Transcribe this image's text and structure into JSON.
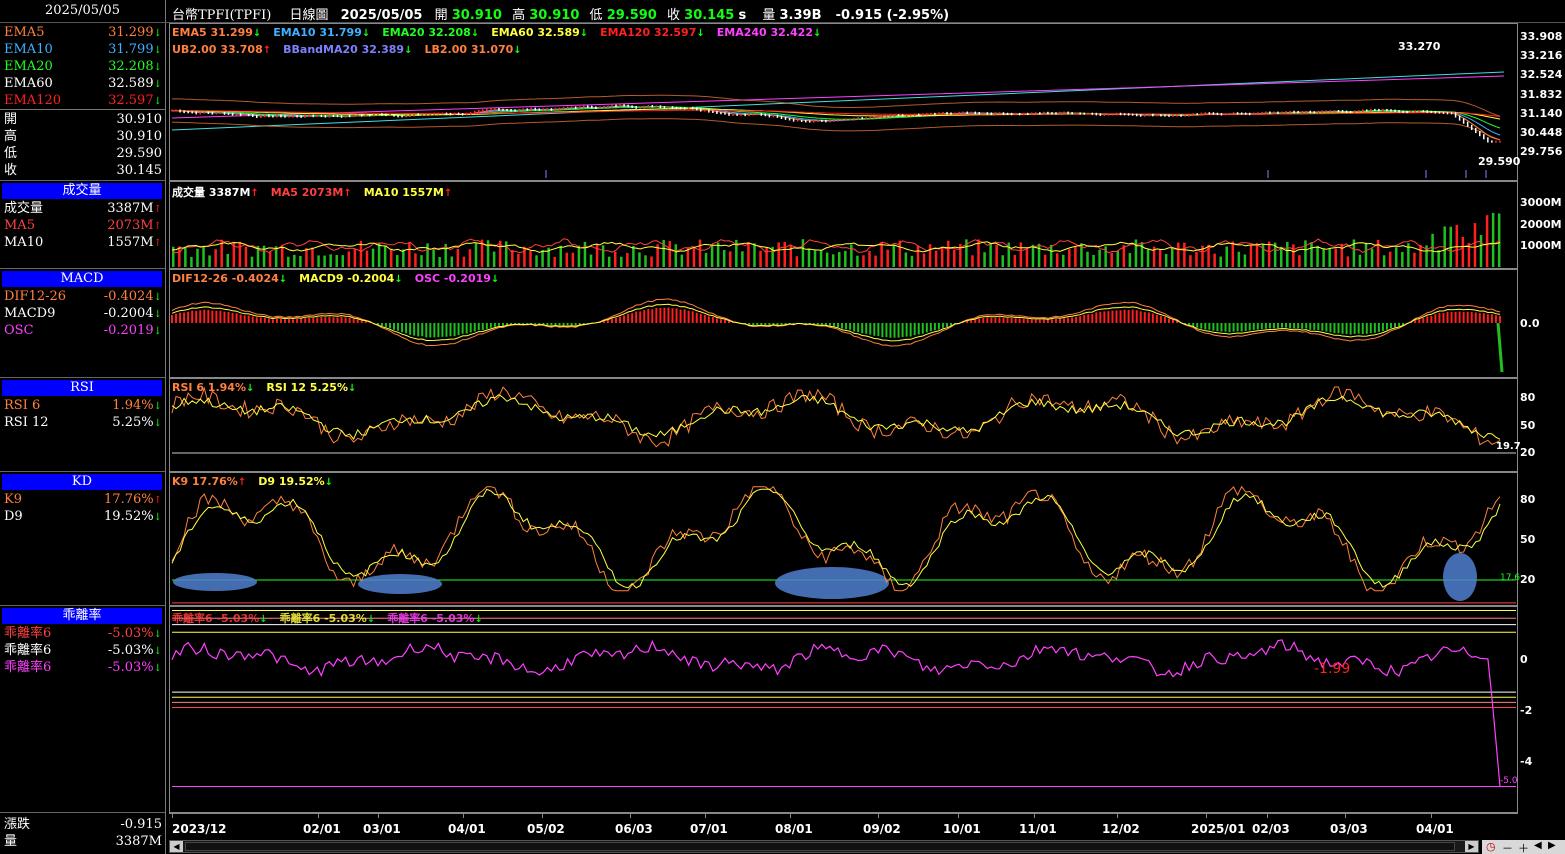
{
  "header": {
    "date": "2025/05/05",
    "instrument": "台幣TPFI(TPFI)",
    "period": "日線圖",
    "bar_date": "2025/05/05",
    "open_label": "開",
    "open": "30.910",
    "high_label": "高",
    "high": "30.910",
    "low_label": "低",
    "low": "29.590",
    "close_label": "收",
    "close": "30.145",
    "close_suffix": "s",
    "vol_label": "量",
    "vol": "3.39B",
    "change": "-0.915 (-2.95%)"
  },
  "sidebar": {
    "ema": [
      {
        "label": "EMA5",
        "value": "31.299",
        "color": "#ff8040",
        "dir": "down"
      },
      {
        "label": "EMA10",
        "value": "31.799",
        "color": "#40b0ff",
        "dir": "down"
      },
      {
        "label": "EMA20",
        "value": "32.208",
        "color": "#20ff20",
        "dir": "down"
      },
      {
        "label": "EMA60",
        "value": "32.589",
        "color": "#ffffff",
        "dir": "down"
      },
      {
        "label": "EMA120",
        "value": "32.597",
        "color": "#ff2020",
        "dir": "down"
      }
    ],
    "ohlc": [
      {
        "label": "開",
        "value": "30.910"
      },
      {
        "label": "高",
        "value": "30.910"
      },
      {
        "label": "低",
        "value": "29.590"
      },
      {
        "label": "收",
        "value": "30.145"
      }
    ],
    "volume": {
      "header": "成交量",
      "rows": [
        {
          "label": "成交量",
          "value": "3387M",
          "color": "#ffffff",
          "dir": "up"
        },
        {
          "label": "MA5",
          "value": "2073M",
          "color": "#ff4040",
          "dir": "up"
        },
        {
          "label": "MA10",
          "value": "1557M",
          "color": "#ffffff",
          "dir": "up"
        }
      ]
    },
    "macd": {
      "header": "MACD",
      "rows": [
        {
          "label": "DIF12-26",
          "value": "-0.4024",
          "color": "#ff8040",
          "dir": "down"
        },
        {
          "label": "MACD9",
          "value": "-0.2004",
          "color": "#ffffff",
          "dir": "down"
        },
        {
          "label": "OSC",
          "value": "-0.2019",
          "color": "#ff40ff",
          "dir": "down"
        }
      ]
    },
    "rsi": {
      "header": "RSI",
      "rows": [
        {
          "label": "RSI 6",
          "value": "1.94%",
          "color": "#ff8040",
          "dir": "down"
        },
        {
          "label": "RSI 12",
          "value": "5.25%",
          "color": "#ffffff",
          "dir": "down"
        }
      ]
    },
    "kd": {
      "header": "KD",
      "rows": [
        {
          "label": "K9",
          "value": "17.76%",
          "color": "#ff8040",
          "dir": "up"
        },
        {
          "label": "D9",
          "value": "19.52%",
          "color": "#ffffff",
          "dir": "down"
        }
      ]
    },
    "bias": {
      "header": "乖離率",
      "rows": [
        {
          "label": "乖離率6",
          "value": "-5.03%",
          "color": "#ff4040",
          "dir": "down"
        },
        {
          "label": "乖離率6",
          "value": "-5.03%",
          "color": "#ffffff",
          "dir": "down"
        },
        {
          "label": "乖離率6",
          "value": "-5.03%",
          "color": "#ff40ff",
          "dir": "down"
        }
      ]
    },
    "bottom": [
      {
        "label": "漲跌",
        "value": "-0.915"
      },
      {
        "label": "量",
        "value": "3387M"
      }
    ]
  },
  "price_panel": {
    "legend1": [
      {
        "text": "EMA5 31.299",
        "color": "#ff8040",
        "dir": "down"
      },
      {
        "text": "EMA10 31.799",
        "color": "#40b0ff",
        "dir": "down"
      },
      {
        "text": "EMA20 32.208",
        "color": "#20ff20",
        "dir": "down"
      },
      {
        "text": "EMA60 32.589",
        "color": "#ffff40",
        "dir": "down"
      },
      {
        "text": "EMA120 32.597",
        "color": "#ff2020",
        "dir": "down"
      },
      {
        "text": "EMA240 32.422",
        "color": "#ff40ff",
        "dir": "down"
      }
    ],
    "legend2": [
      {
        "text": "UB2.00 33.708",
        "color": "#ff8040",
        "dir": "up"
      },
      {
        "text": "BBandMA20 32.389",
        "color": "#8080ff",
        "dir": "down"
      },
      {
        "text": "LB2.00 31.070",
        "color": "#ff8040",
        "dir": "down"
      }
    ],
    "y_ticks": [
      "33.908",
      "33.216",
      "32.524",
      "31.832",
      "31.140",
      "30.448",
      "29.756"
    ],
    "high_mark": "33.270",
    "low_mark": "29.590"
  },
  "volume_panel": {
    "legend": [
      {
        "text": "成交量 3387M",
        "color": "#ffffff",
        "dir": "up"
      },
      {
        "text": "MA5 2073M",
        "color": "#ff4040",
        "dir": "up"
      },
      {
        "text": "MA10 1557M",
        "color": "#ffff40",
        "dir": "up"
      }
    ],
    "y_ticks": [
      "3000M",
      "2000M",
      "1000M"
    ]
  },
  "macd_panel": {
    "legend": [
      {
        "text": "DIF12-26 -0.4024",
        "color": "#ff8040",
        "dir": "down"
      },
      {
        "text": "MACD9 -0.2004",
        "color": "#ffff40",
        "dir": "down"
      },
      {
        "text": "OSC -0.2019",
        "color": "#ff40ff",
        "dir": "down"
      }
    ],
    "y_ticks": [
      "0.0"
    ]
  },
  "rsi_panel": {
    "legend": [
      {
        "text": "RSI 6 1.94%",
        "color": "#ff8040",
        "dir": "down"
      },
      {
        "text": "RSI 12 5.25%",
        "color": "#ffff40",
        "dir": "down"
      }
    ],
    "y_ticks": [
      "80",
      "50",
      "20"
    ],
    "marker": "19.7"
  },
  "kd_panel": {
    "legend": [
      {
        "text": "K9 17.76%",
        "color": "#ff8040",
        "dir": "up"
      },
      {
        "text": "D9 19.52%",
        "color": "#ffff40",
        "dir": "down"
      }
    ],
    "y_ticks": [
      "80",
      "50",
      "20"
    ],
    "marker": "17.6"
  },
  "bias_panel": {
    "legend": [
      {
        "text": "乖離率6 -5.03%",
        "color": "#ff4040",
        "dir": "down"
      },
      {
        "text": "乖離率6 -5.03%",
        "color": "#ffff40",
        "dir": "down"
      },
      {
        "text": "乖離率6 -5.03%",
        "color": "#ff40ff",
        "dir": "down"
      }
    ],
    "y_ticks": [
      "0",
      "-2",
      "-4"
    ],
    "annotation": "-1.99",
    "marker": "-5.0"
  },
  "x_axis": [
    "2023/12",
    "02/01",
    "03/01",
    "04/01",
    "05/02",
    "06/03",
    "07/01",
    "08/01",
    "09/02",
    "10/01",
    "11/01",
    "12/02",
    "2025/01",
    "02/03",
    "03/03",
    "04/01"
  ]
}
